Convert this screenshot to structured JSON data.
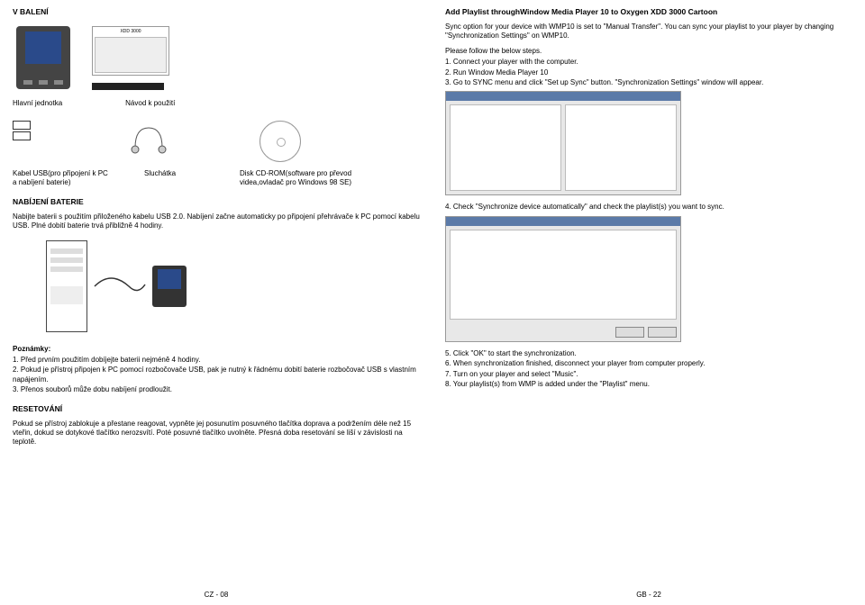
{
  "left": {
    "title": "V BALENÍ",
    "main_unit_caption": "Hlavní jednotka",
    "manual_caption": "Návod k použití",
    "manual_small_top": "XDD 3000",
    "items": {
      "cable": {
        "title": "Kabel USB(pro připojení k PC a nabíjení baterie)"
      },
      "earphones": {
        "title": "Sluchátka"
      },
      "disc": {
        "title": "Disk CD-ROM(software pro převod videa,ovladač pro Windows 98 SE)"
      }
    },
    "charging_hdr": "NABÍJENÍ BATERIE",
    "charging_para": "Nabijte baterii s použitím přiloženého kabelu USB 2.0. Nabíjení začne automaticky po připojení přehrávače k PC pomocí kabelu USB. Plné dobití baterie trvá přibližně 4 hodiny.",
    "notes_hdr": "Poznámky:",
    "notes": {
      "n1": "1. Před prvním použitím dobíjejte baterii nejméně 4 hodiny.",
      "n2": "2. Pokud je přístroj připojen k PC pomocí rozbočovače USB, pak je nutný k řádnému dobití baterie rozbočovač USB s vlastním napájením.",
      "n3": "3. Přenos souborů může dobu nabíjení prodloužit."
    },
    "reset_hdr": "RESETOVÁNÍ",
    "reset_para": "Pokud se přístroj zablokuje a přestane reagovat, vypněte jej posunutím posuvného tlačítka doprava a podržením déle než 15 vteřin, dokud se dotykové tlačítko nerozsvítí. Poté posuvné tlačítko uvolněte. Přesná doba resetování se liší v závislosti na teplotě.",
    "footer": "CZ - 08"
  },
  "right": {
    "title": "Add Playlist throughWindow Media Player 10 to Oxygen XDD 3000 Cartoon",
    "intro": "Sync option for your device with WMP10 is set to \"Manual Transfer\". You can sync your playlist to your player by changing \"Synchronization Settings\" on WMP10.",
    "follow": "Please follow the below steps.",
    "steps_a": {
      "s1": "1. Connect your player with the computer.",
      "s2": "2. Run Window Media Player 10",
      "s3": "3. Go to SYNC menu and click \"Set up Sync\" button. \"Synchronization Settings\" window will appear."
    },
    "step4": "4. Check \"Synchronize device automatically\" and check the playlist(s) you want to sync.",
    "steps_b": {
      "s5": "5. Click \"OK\" to start the synchronization.",
      "s6": "6. When synchronization finished, disconnect your player from computer properly.",
      "s7": "7. Turn on your player and select \"Music\".",
      "s8": "8. Your playlist(s) from WMP is added under the \"Playlist\" menu."
    },
    "footer": "GB - 22"
  }
}
